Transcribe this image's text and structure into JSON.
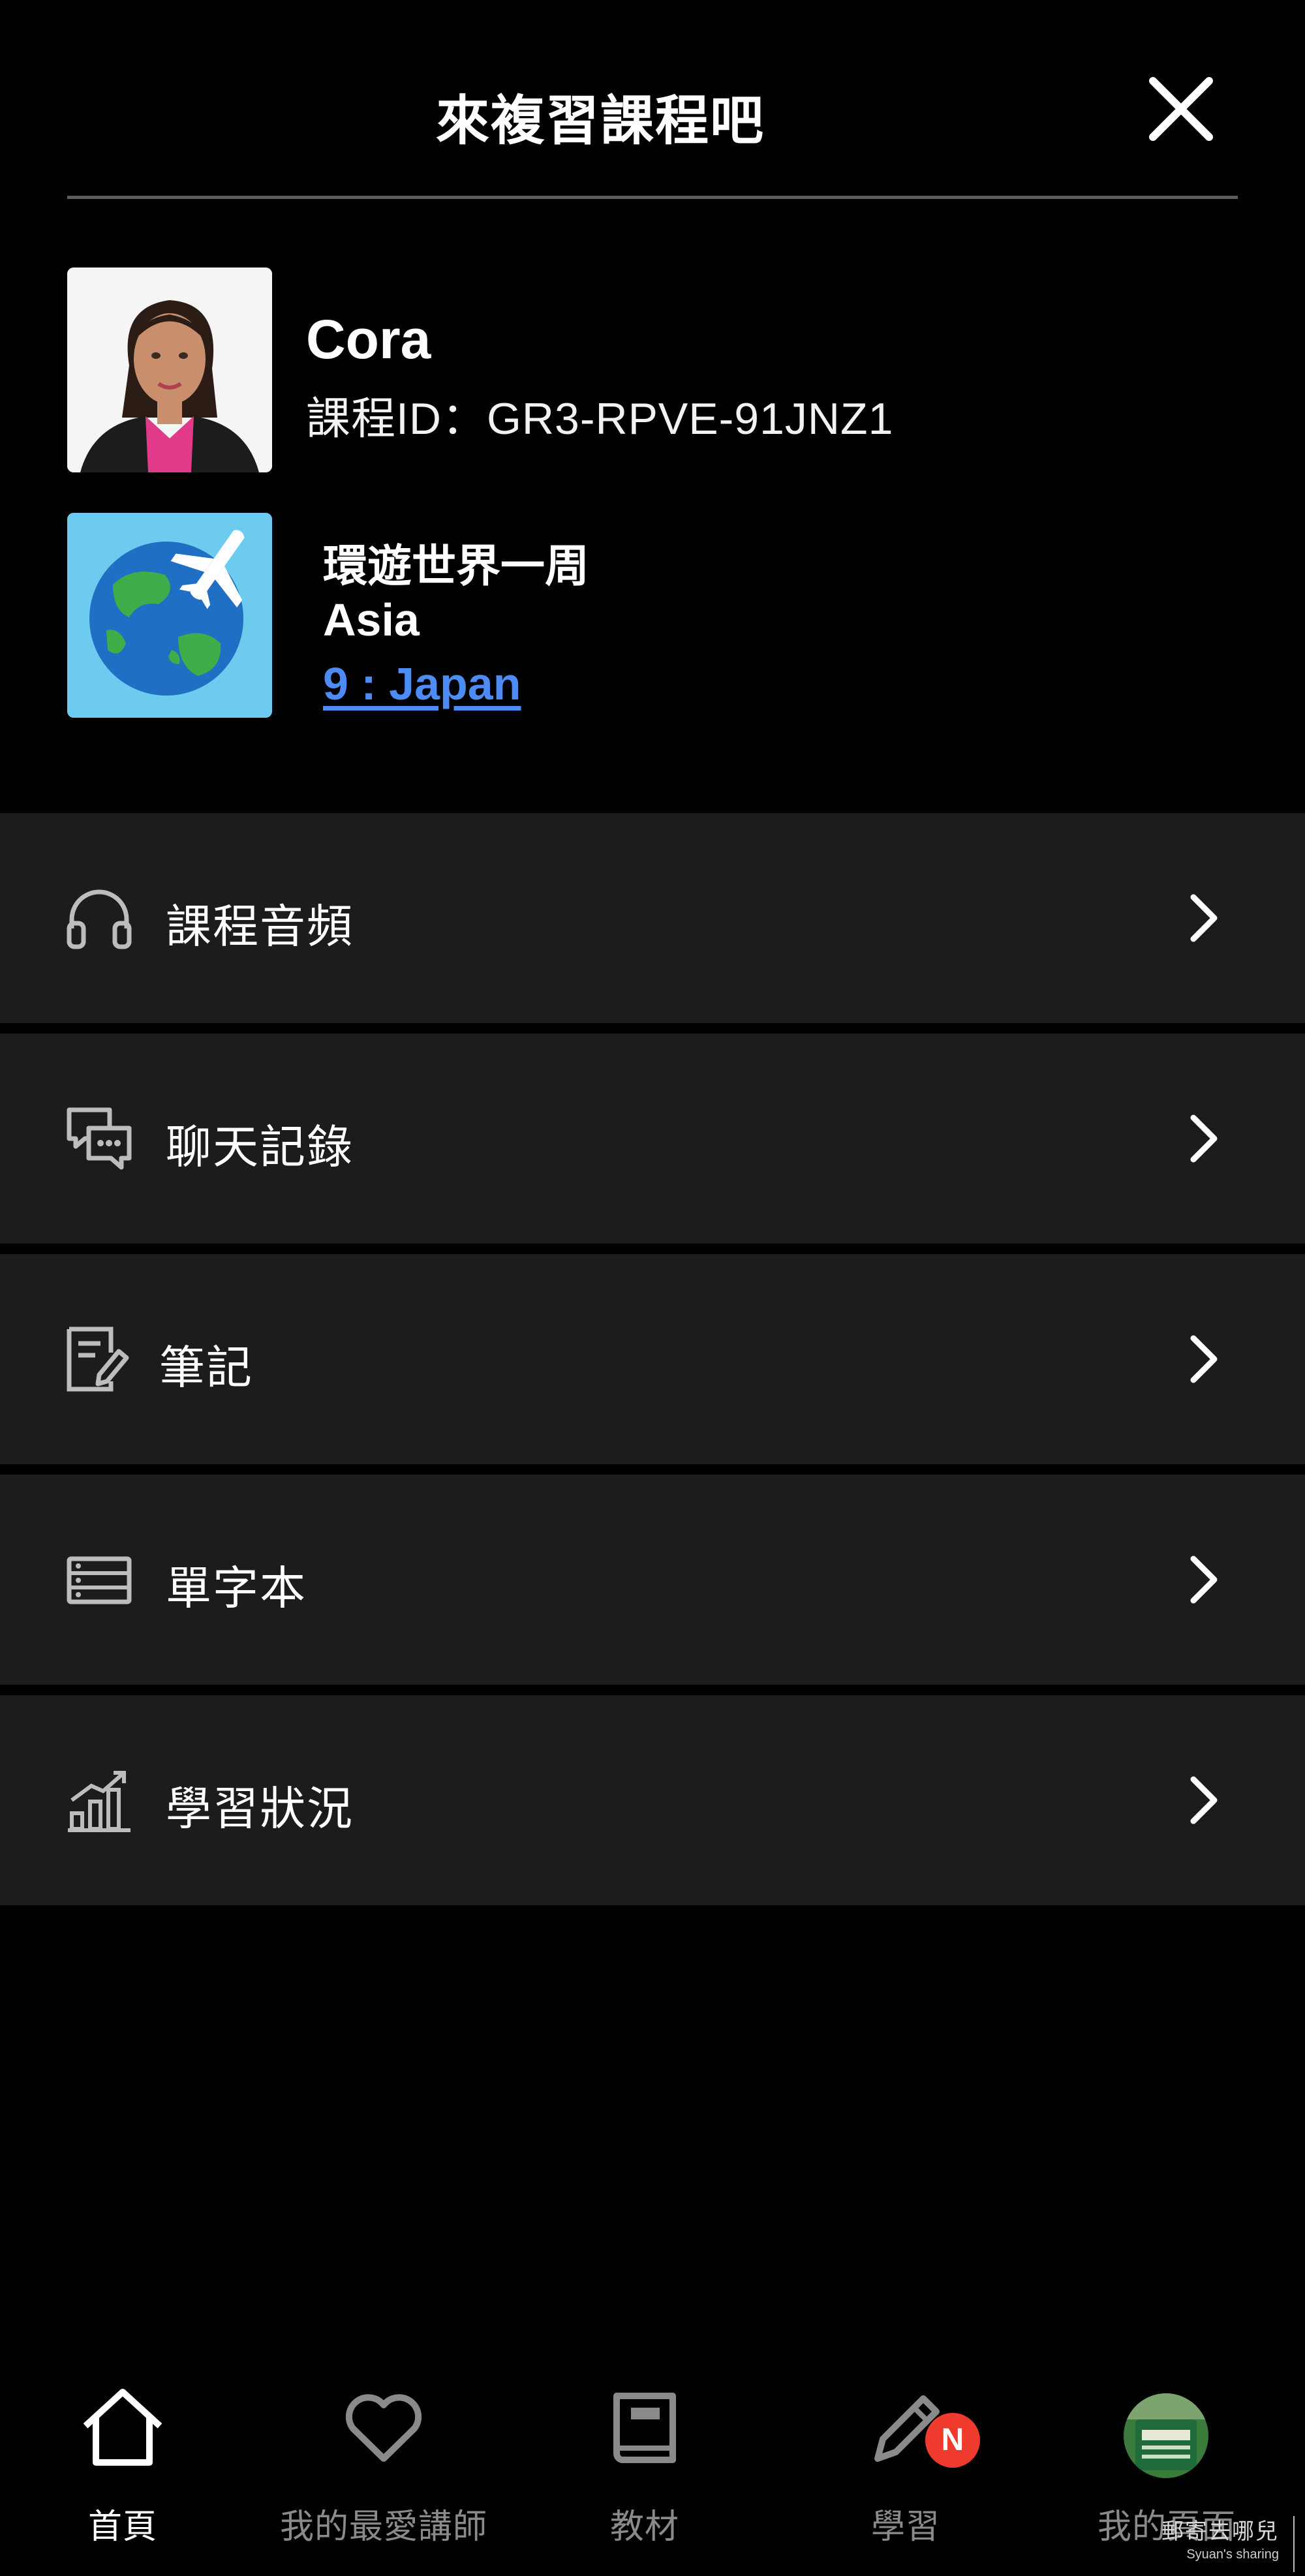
{
  "header": {
    "title": "來複習課程吧",
    "close_icon": "close-icon"
  },
  "teacher": {
    "name": "Cora",
    "course_id": "課程ID：GR3-RPVE-91JNZ1"
  },
  "course": {
    "series": "環遊世界一周",
    "region": "Asia",
    "lesson": "9 : Japan",
    "thumbnail_icon": "globe-airplane-icon"
  },
  "menu": [
    {
      "label": "課程音頻",
      "icon": "headphones-icon"
    },
    {
      "label": "聊天記錄",
      "icon": "chat-bubbles-icon"
    },
    {
      "label": "筆記",
      "icon": "notes-icon"
    },
    {
      "label": "單字本",
      "icon": "vocabulary-list-icon"
    },
    {
      "label": "學習狀況",
      "icon": "bar-chart-growth-icon"
    }
  ],
  "tabbar": [
    {
      "label": "首頁",
      "icon": "home-icon",
      "active": true
    },
    {
      "label": "我的最愛講師",
      "icon": "heart-icon",
      "active": false
    },
    {
      "label": "教材",
      "icon": "book-icon",
      "active": false
    },
    {
      "label": "學習",
      "icon": "pencil-icon",
      "active": false,
      "badge": "N"
    },
    {
      "label": "我的頁面",
      "icon": "profile-avatar",
      "active": false
    }
  ],
  "watermark": {
    "line1": "郵寄去哪兒",
    "line2": "Syuan's sharing"
  },
  "colors": {
    "background": "#000000",
    "menu_background": "#1c1c1e",
    "link": "#4d8cf5",
    "badge": "#ef3b2d",
    "inactive_tab": "#8a8a8a"
  }
}
